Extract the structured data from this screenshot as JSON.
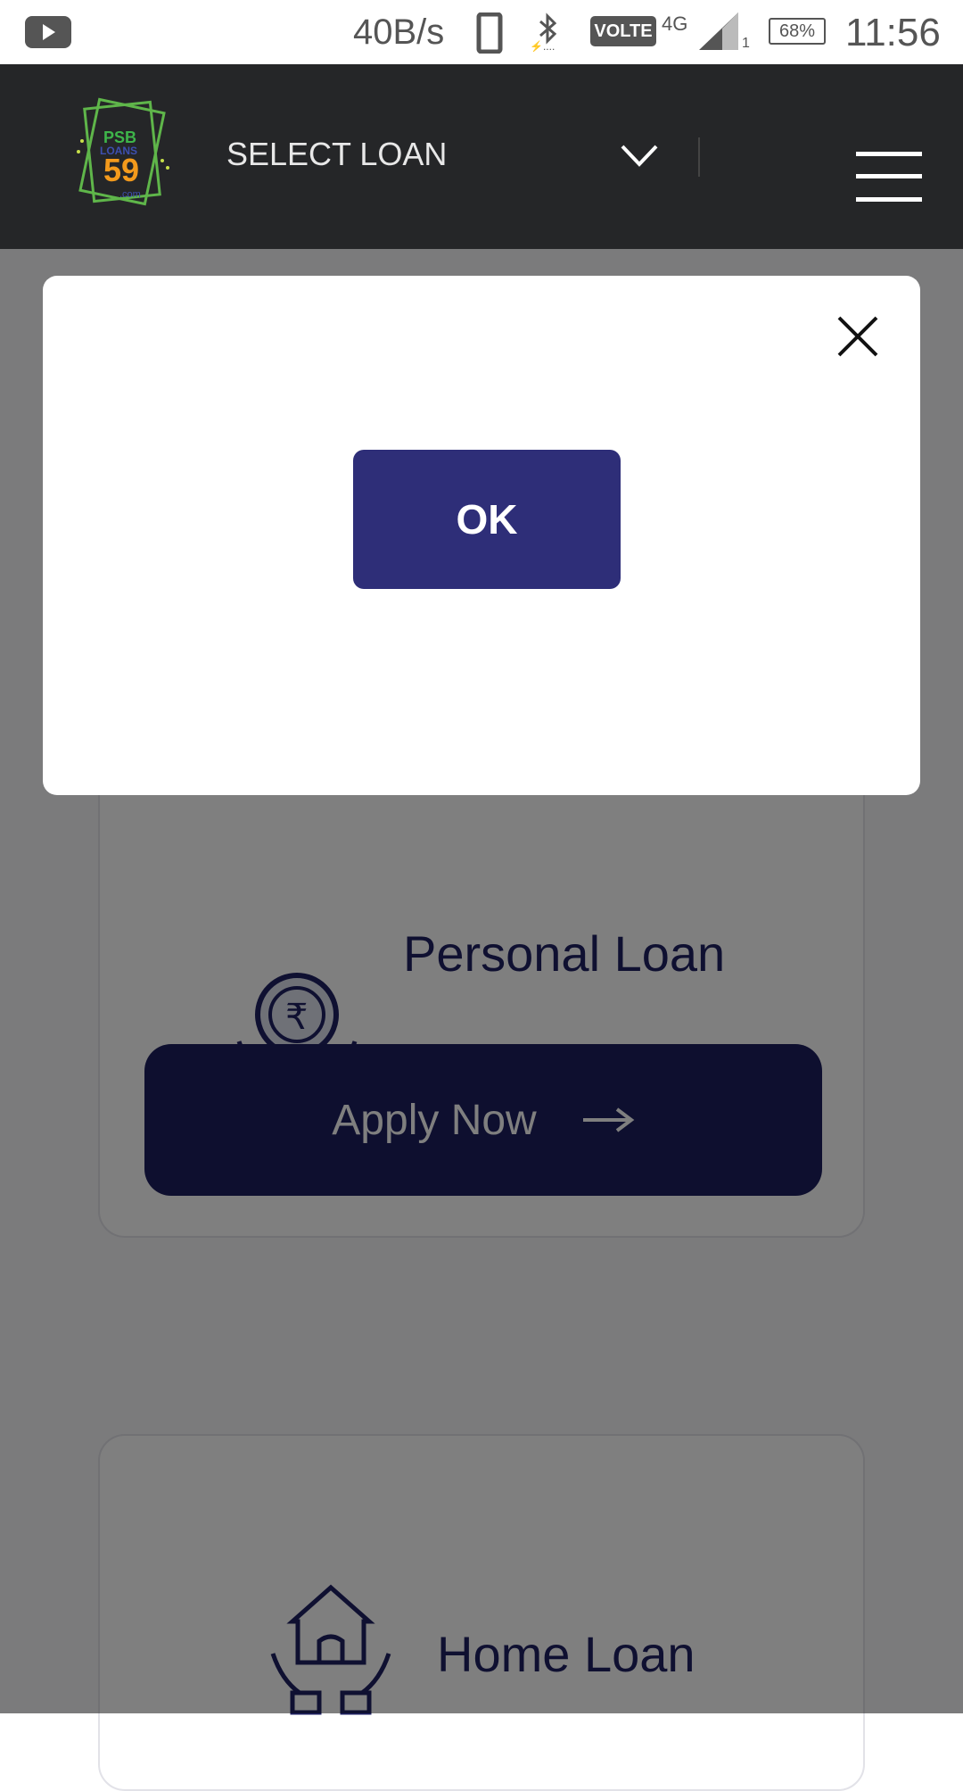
{
  "status_bar": {
    "speed": "40B/s",
    "network": "VOLTE",
    "network_type": "4G",
    "sim_slot": "1",
    "battery": "68%",
    "time": "11:56",
    "icons": [
      "youtube-icon",
      "phone-icon",
      "bluetooth-icon",
      "volte-icon",
      "signal-icon",
      "battery-icon"
    ]
  },
  "header": {
    "logo": {
      "line1": "PSB",
      "line2": "LOANS",
      "number": "59",
      "suffix": ".com"
    },
    "select_label": "SELECT LOAN",
    "icons": [
      "chevron-down-icon",
      "menu-icon"
    ]
  },
  "modal": {
    "ok_label": "OK",
    "icons": [
      "close-icon"
    ]
  },
  "cards": [
    {
      "title": "Personal Loan",
      "button": "Apply Now",
      "icon": "rupee-hands-icon"
    },
    {
      "title": "Home Loan",
      "icon": "house-hands-icon"
    }
  ],
  "colors": {
    "header_bg": "#252628",
    "brand_navy": "#1d1f5e",
    "ok_button": "#2e2e78",
    "title_text": "#1f2163"
  }
}
